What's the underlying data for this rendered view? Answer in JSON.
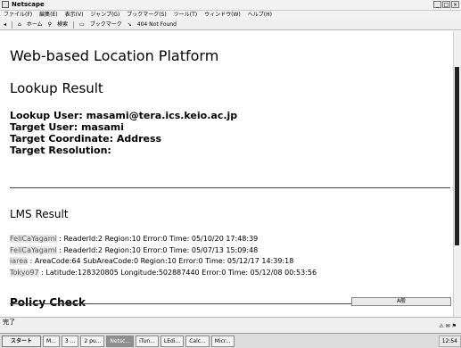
{
  "window": {
    "title": "Netscape"
  },
  "menu": [
    "ファイル(F)",
    "編集(E)",
    "表示(V)",
    "ジャンプ(G)",
    "ブックマーク(S)",
    "ツール(T)",
    "ウィンドウ(W)",
    "ヘルプ(H)"
  ],
  "nav": {
    "home": "ホーム",
    "search": "検索",
    "bookmarks": "ブックマーク",
    "status": "404 Not Found"
  },
  "page": {
    "title": "Web-based Location Platform",
    "lookup_heading": "Lookup Result",
    "lookup_user": "Lookup User: masami@tera.ics.keio.ac.jp",
    "target_user": "Target User: masami",
    "target_coordinate": "Target Coordinate: Address",
    "target_resolution": "Target Resolution:",
    "lms_heading": "LMS Result",
    "results": [
      {
        "source": "FeliCaYagami",
        "text": " : ReaderId:2 Region:10 Error:0 Time: 05/10/20 17:48:39"
      },
      {
        "source": "FeliCaYagami",
        "text": " : ReaderId:2 Region:10 Error:0 Time: 05/07/13 15:09:48"
      },
      {
        "source": "iarea",
        "text": " : AreaCode:64 SubAreaCode:0 Region:10 Error:0 Time: 05/12/17 14:39:18"
      },
      {
        "source": "Tokyo97",
        "text": " : Latitude:128320805 Longitude:502887440 Error:0 Time: 05/12/08 00:53:56"
      }
    ],
    "policy_heading": "Policy Check"
  },
  "ime": {
    "label": "A般"
  },
  "status": {
    "text": "完了"
  },
  "taskbar": {
    "start": "スタート",
    "buttons": [
      "M...",
      "3 ...",
      "2 pu...",
      "Netsc...",
      "iTun...",
      "LEdi...",
      "Calc...",
      "Micr..."
    ],
    "active_index": 3,
    "clock": "12:54"
  }
}
